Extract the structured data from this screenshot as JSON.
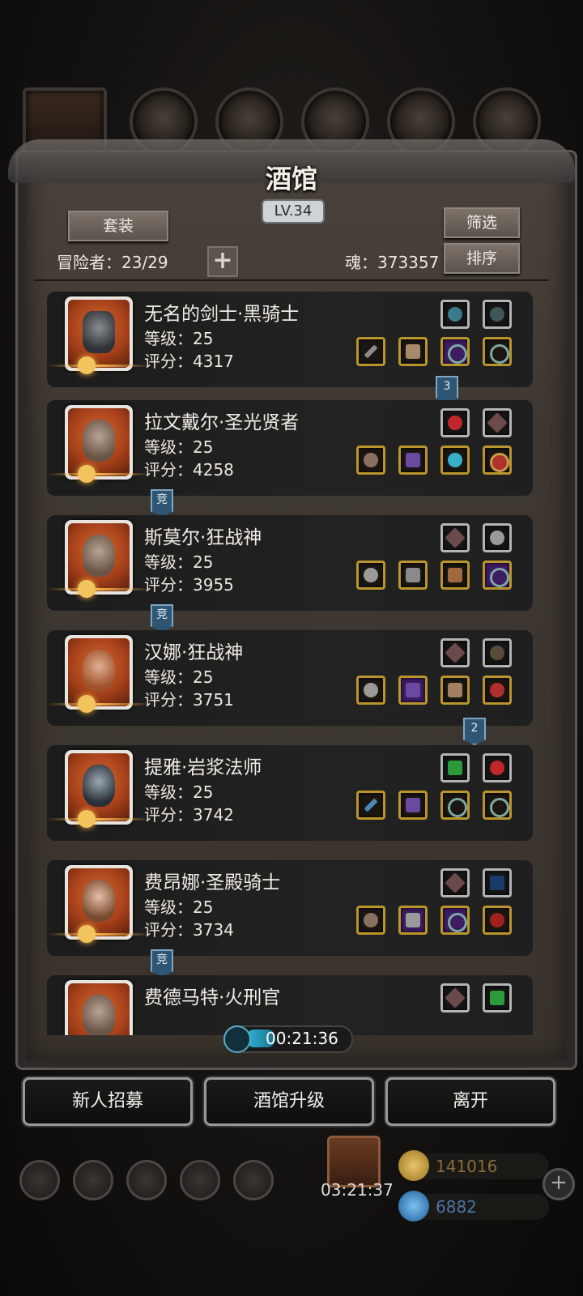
{
  "tavern": {
    "title": "酒馆",
    "level": "LV.34",
    "suit_button": "套装",
    "filter_button": "筛选",
    "sort_button": "排序",
    "adventurers_label": "冒险者：23/29",
    "plus_label": "+",
    "soul_label": "魂：373357"
  },
  "heroes": [
    {
      "name": "无名的剑士·黑骑士",
      "level": "等级：25",
      "score": "评分：4317"
    },
    {
      "name": "拉文戴尔·圣光贤者",
      "level": "等级：25",
      "score": "评分：4258"
    },
    {
      "name": "斯莫尔·狂战神",
      "level": "等级：25",
      "score": "评分：3955"
    },
    {
      "name": "汉娜·狂战神",
      "level": "等级：25",
      "score": "评分：3751"
    },
    {
      "name": "提雅·岩浆法师",
      "level": "等级：25",
      "score": "评分：3742"
    },
    {
      "name": "费昂娜·圣殿骑士",
      "level": "等级：25",
      "score": "评分：3734"
    },
    {
      "name": "费德马特·火刑官",
      "level": "",
      "score": ""
    }
  ],
  "tags": {
    "t1": "3",
    "t2": "竞",
    "t3": "竞",
    "t4": "2",
    "t5": "竞"
  },
  "timer": {
    "text": "00:21:36",
    "progress": 0.3
  },
  "bottom": {
    "recruit": "新人招募",
    "upgrade": "酒馆升级",
    "leave": "离开"
  },
  "hud": {
    "gift_timer": "03:21:37",
    "gold": "141016",
    "gems": "6882",
    "plus": "+"
  },
  "colors": {
    "gold_frame": "#b9952c",
    "silver_frame": "#b4b4b4",
    "purple_slot": "#3d1c63",
    "tag_blue": "#2e5574"
  }
}
